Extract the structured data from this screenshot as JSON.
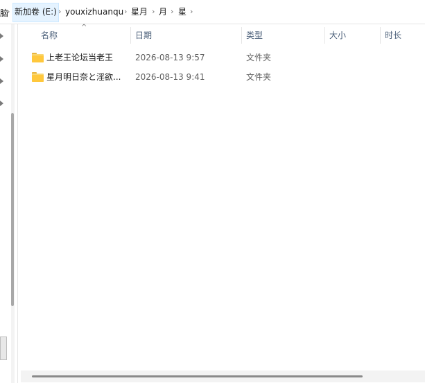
{
  "breadcrumb": {
    "cut_prefix": "脑",
    "items": [
      {
        "label": "新加卷 (E:)"
      },
      {
        "label": "youxizhuanqu"
      },
      {
        "label": "星月"
      },
      {
        "label": "月"
      },
      {
        "label": "星"
      }
    ],
    "separator": "›"
  },
  "columns": {
    "name": "名称",
    "date": "日期",
    "type": "类型",
    "size": "大小",
    "duration": "时长",
    "sort_indicator": "^"
  },
  "files": [
    {
      "name": "上老王论坛当老王",
      "date": "2026-08-13 9:57",
      "type": "文件夹",
      "icon": "folder-icon"
    },
    {
      "name": "星月明日奈と淫欲...",
      "date": "2026-08-13 9:41",
      "type": "文件夹",
      "icon": "folder-icon"
    }
  ],
  "colors": {
    "folder": "#ffc83d",
    "header_text": "#4c607a",
    "active_crumb": "#e5f3ff"
  }
}
